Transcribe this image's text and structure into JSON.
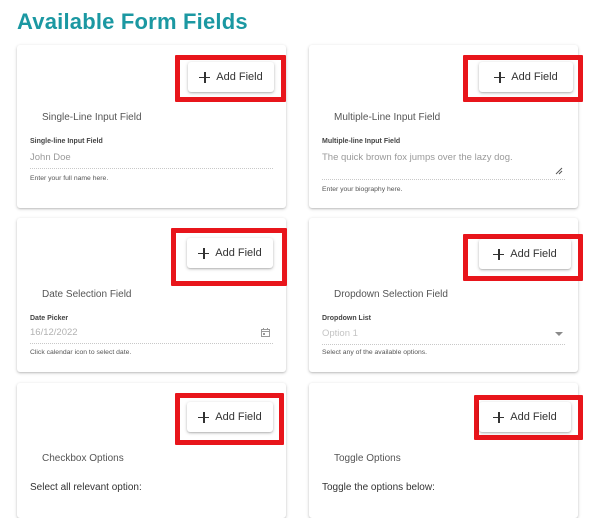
{
  "page": {
    "title": "Available Form Fields"
  },
  "colors": {
    "accent": "#1b98a2",
    "highlight": "#e8151b"
  },
  "cards": [
    {
      "add_button": {
        "label": "Add Field",
        "icon": "plus-icon"
      },
      "title": "Single-Line Input Field",
      "field_label": "Single-line Input Field",
      "value": "John Doe",
      "helper": "Enter your full name here."
    },
    {
      "add_button": {
        "label": "Add Field",
        "icon": "plus-icon"
      },
      "title": "Multiple-Line Input Field",
      "field_label": "Multiple-line Input Field",
      "value": "The quick brown fox jumps over the lazy dog.",
      "helper": "Enter your biography here.",
      "icon": "resize-handle-icon"
    },
    {
      "add_button": {
        "label": "Add Field",
        "icon": "plus-icon"
      },
      "title": "Date Selection Field",
      "field_label": "Date Picker",
      "value": "16/12/2022",
      "helper": "Click calendar icon to select date.",
      "icon": "calendar-icon"
    },
    {
      "add_button": {
        "label": "Add Field",
        "icon": "plus-icon"
      },
      "title": "Dropdown Selection Field",
      "field_label": "Dropdown List",
      "value": "Option 1",
      "helper": "Select any of the available options.",
      "icon": "chevron-down-icon"
    },
    {
      "add_button": {
        "label": "Add Field",
        "icon": "plus-icon"
      },
      "title": "Checkbox Options",
      "text": "Select all relevant option:"
    },
    {
      "add_button": {
        "label": "Add Field",
        "icon": "plus-icon"
      },
      "title": "Toggle Options",
      "text": "Toggle the options below:"
    }
  ]
}
